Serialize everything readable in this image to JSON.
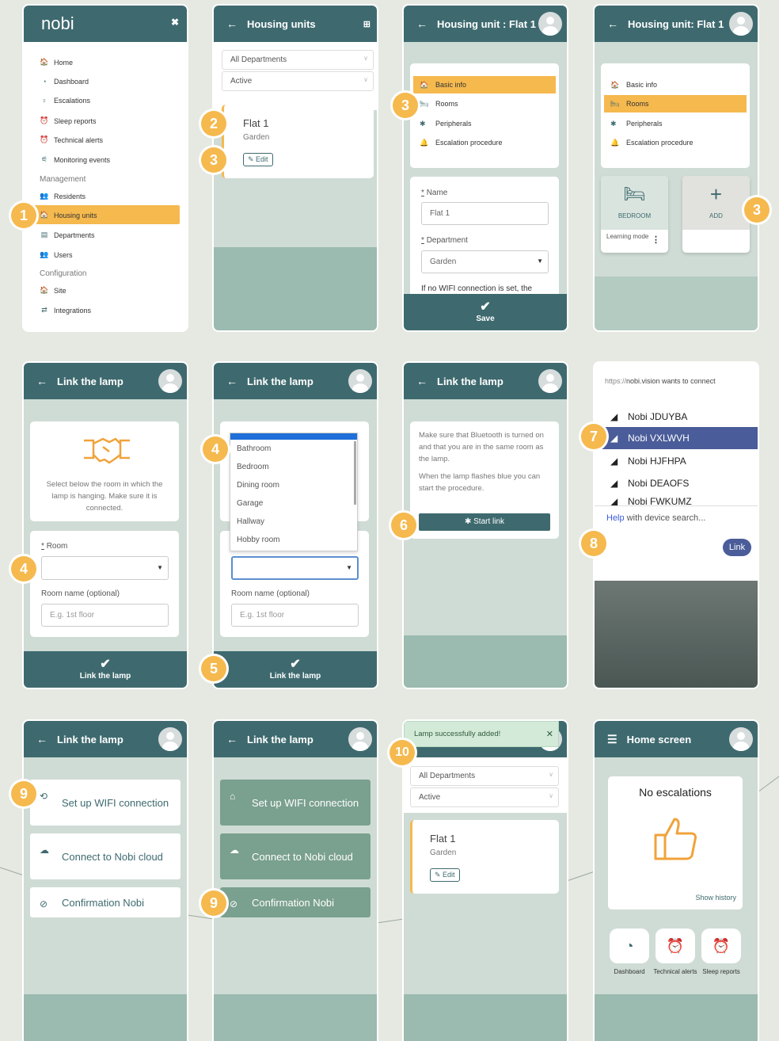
{
  "colors": {
    "primary": "#3e6a6f",
    "accent": "#f5b94e",
    "bg_light": "#cfdcd5",
    "bg_dark": "#9bbab0"
  },
  "s1": {
    "logo": "nobi",
    "items": [
      {
        "icon": "home-icon",
        "glyph": "🏠",
        "label": "Home"
      },
      {
        "icon": "dashboard-icon",
        "glyph": "◔",
        "label": "Dashboard"
      },
      {
        "icon": "escalations-icon",
        "glyph": "♀",
        "label": "Escalations"
      },
      {
        "icon": "sleep-icon",
        "glyph": "⏰",
        "label": "Sleep reports"
      },
      {
        "icon": "alert-icon",
        "glyph": "⏰",
        "label": "Technical alerts"
      },
      {
        "icon": "monitor-icon",
        "glyph": "⚟",
        "label": "Monitoring events"
      }
    ],
    "mgmt_title": "Management",
    "mgmt": [
      {
        "icon": "residents-icon",
        "glyph": "👥",
        "label": "Residents"
      },
      {
        "icon": "housing-icon",
        "glyph": "🏠",
        "label": "Housing units"
      },
      {
        "icon": "departments-icon",
        "glyph": "▤",
        "label": "Departments"
      },
      {
        "icon": "users-icon",
        "glyph": "👥",
        "label": "Users"
      }
    ],
    "config_title": "Configuration",
    "config": [
      {
        "icon": "site-icon",
        "glyph": "🏠",
        "label": "Site"
      },
      {
        "icon": "integrations-icon",
        "glyph": "⇄",
        "label": "Integrations"
      }
    ]
  },
  "s2": {
    "title": "Housing units",
    "filter_dept": "All Departments",
    "filter_status": "Active",
    "unit_name": "Flat 1",
    "unit_dept": "Garden",
    "edit": "Edit"
  },
  "s3": {
    "title": "Housing unit : Flat 1",
    "tabs": [
      "Basic info",
      "Rooms",
      "Peripherals",
      "Escalation procedure"
    ],
    "name_label": "Name",
    "name_value": "Flat 1",
    "dept_label": "Department",
    "dept_value": "Garden",
    "note": "If no WIFI connection is set, the",
    "save": "Save"
  },
  "s4": {
    "title": "Housing unit: Flat 1",
    "tabs": [
      "Basic info",
      "Rooms",
      "Peripherals",
      "Escalation procedure"
    ],
    "room": "BEDROOM",
    "learning": "Learning mode",
    "add": "ADD"
  },
  "s5": {
    "title": "Link the lamp",
    "info": "Select below the room in which the lamp is hanging. Make sure it is connected.",
    "room_label": "Room",
    "room_name_label": "Room name (optional)",
    "placeholder": "E.g. 1st floor",
    "button": "Link the lamp"
  },
  "s6": {
    "title": "Link the lamp",
    "options": [
      "Bathroom",
      "Bedroom",
      "Dining room",
      "Garage",
      "Hallway",
      "Hobby room"
    ],
    "room_name_label": "Room name (optional)",
    "placeholder": "E.g. 1st floor",
    "button": "Link the lamp"
  },
  "s7": {
    "title": "Link the lamp",
    "p1": "Make sure that Bluetooth is turned on and that you are in the same room as the lamp.",
    "p2": "When the lamp flashes blue you can start the procedure.",
    "button": "Start link"
  },
  "s8": {
    "url_prefix": "https://",
    "url_host": "nobi.vision",
    "url_suffix": " wants to connect",
    "devices": [
      "Nobi JDUYBA",
      "Nobi VXLWVH",
      "Nobi HJFHPA",
      "Nobi DEAOFS",
      "Nobi FWKUMZ"
    ],
    "help_link": "Help",
    "help_rest": " with device search...",
    "button": "Link"
  },
  "s9": {
    "title": "Link the lamp",
    "steps": [
      "Set up WIFI connection",
      "Connect to Nobi cloud",
      "Confirmation Nobi"
    ]
  },
  "s10": {
    "title": "Link the lamp",
    "steps": [
      "Set up WIFI connection",
      "Connect to Nobi cloud",
      "Confirmation Nobi"
    ]
  },
  "s11": {
    "toast": "Lamp successfully added!",
    "filter_dept": "All Departments",
    "filter_status": "Active",
    "unit_name": "Flat 1",
    "unit_dept": "Garden",
    "edit": "Edit"
  },
  "s12": {
    "title": "Home screen",
    "heading": "No escalations",
    "history": "Show history",
    "nav": [
      "Dashboard",
      "Technical alerts",
      "Sleep reports"
    ]
  },
  "badges": [
    "1",
    "2",
    "3",
    "3",
    "3",
    "4",
    "4",
    "5",
    "6",
    "7",
    "8",
    "9",
    "9",
    "10"
  ]
}
